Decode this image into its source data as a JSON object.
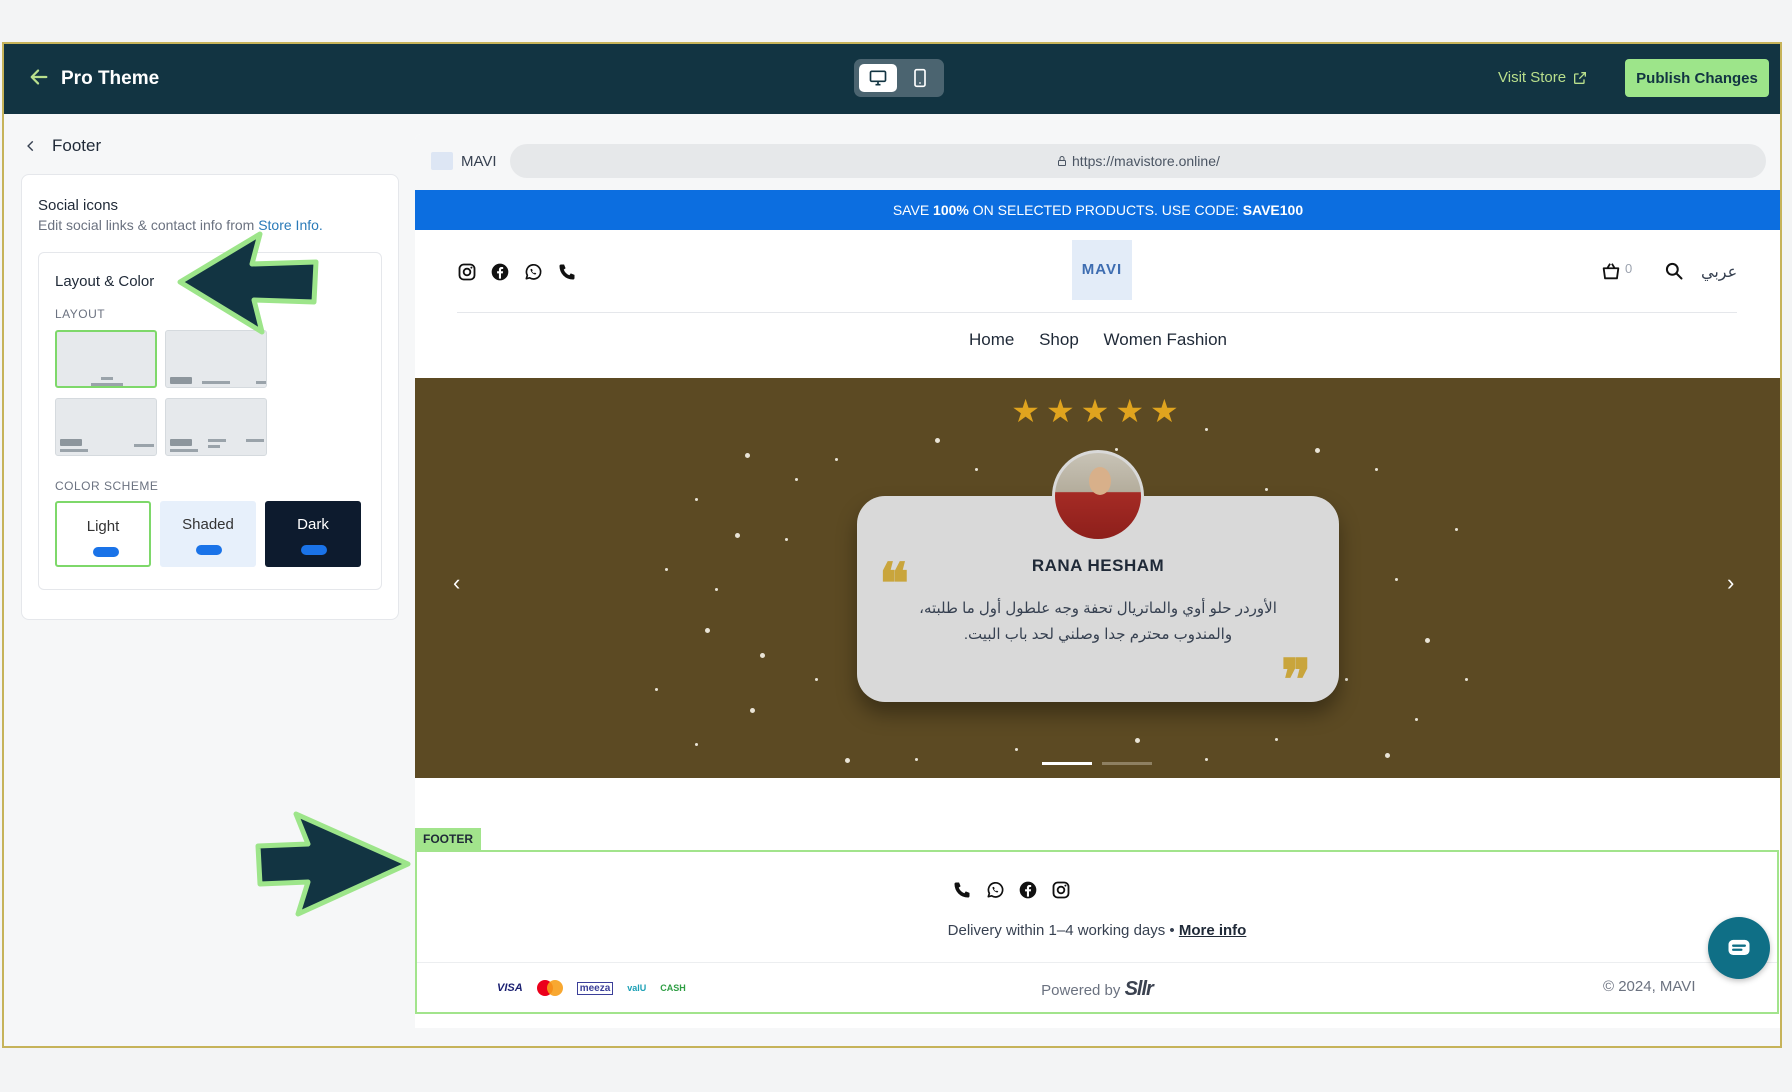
{
  "topbar": {
    "title": "Pro Theme",
    "visit_store": "Visit Store",
    "publish": "Publish Changes"
  },
  "sidebar": {
    "back_label": "Footer",
    "social_title": "Social icons",
    "social_desc": "Edit social links & contact info from",
    "social_link": "Store Info.",
    "layout_color_title": "Layout & Color",
    "layout_label": "LAYOUT",
    "color_scheme_label": "COLOR SCHEME",
    "schemes": [
      "Light",
      "Shaded",
      "Dark"
    ]
  },
  "browser": {
    "tab": "MAVI",
    "url": "https://mavistore.online/"
  },
  "store": {
    "announce_pre": "SAVE",
    "announce_pct": "100%",
    "announce_mid": "ON SELECTED PRODUCTS. USE CODE:",
    "announce_code": "SAVE100",
    "logo": "MAVI",
    "cart_count": "0",
    "lang": "عربي",
    "nav": [
      "Home",
      "Shop",
      "Women Fashion"
    ]
  },
  "testimonial": {
    "stars": "★★★★★",
    "name": "RANA HESHAM",
    "line1": "الأوردر حلو أوي والماتريال تحفة وجه علطول أول ما طلبته،",
    "line2": "والمندوب محترم جدا وصلني لحد باب البيت.",
    "prev": "‹",
    "next": "›",
    "quote_open": "❝",
    "quote_close": "❞"
  },
  "footer": {
    "tag": "FOOTER",
    "delivery": "Delivery within 1–4 working days •",
    "more_info": "More info",
    "powered_by": "Powered by",
    "brand": "Sllr",
    "copyright": "© 2024, MAVI",
    "payments": [
      "VISA",
      "mastercard",
      "meeza",
      "valU",
      "CASH"
    ]
  },
  "colors": {
    "topbar_bg": "#123442",
    "accent_green": "#9de58a",
    "announce_blue": "#0c6ee0",
    "testimonial_bg": "#5c4a23",
    "star_gold": "#e0a41e"
  }
}
